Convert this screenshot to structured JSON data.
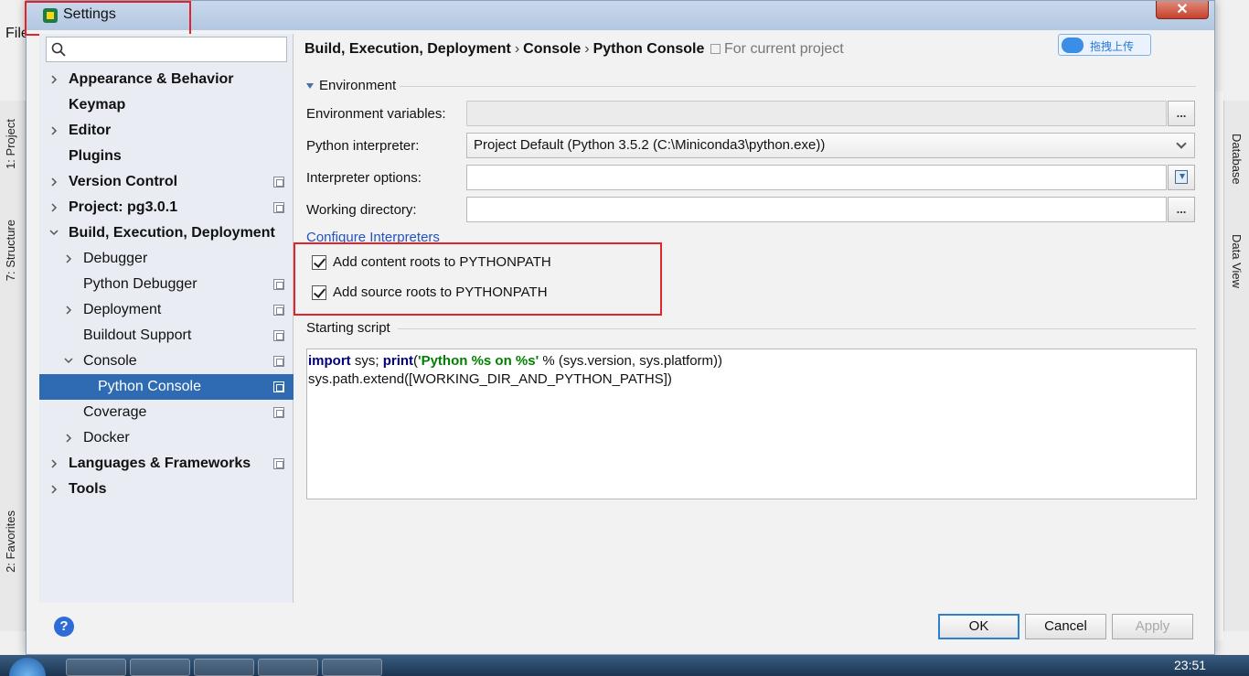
{
  "window": {
    "title": "Settings",
    "close_glyph": "✕"
  },
  "ide": {
    "menu_file": "File",
    "left_tabs": [
      "1: Project",
      "7: Structure",
      "2: Favorites"
    ],
    "right_tabs": [
      "Database",
      "Data View"
    ]
  },
  "breadcrumb": [
    "Build, Execution, Deployment",
    "Console",
    "Python Console"
  ],
  "breadcrumb_sep": "›",
  "scope": "For current project",
  "upload_button": "拖拽上传",
  "search": {
    "value": "",
    "placeholder": ""
  },
  "tree": [
    {
      "label": "Appearance & Behavior",
      "level": 0,
      "expandable": true,
      "bold": true,
      "copy": false
    },
    {
      "label": "Keymap",
      "level": 0,
      "expandable": false,
      "bold": true,
      "copy": false
    },
    {
      "label": "Editor",
      "level": 0,
      "expandable": true,
      "bold": true,
      "copy": false
    },
    {
      "label": "Plugins",
      "level": 0,
      "expandable": false,
      "bold": true,
      "copy": false
    },
    {
      "label": "Version Control",
      "level": 0,
      "expandable": true,
      "bold": true,
      "copy": true
    },
    {
      "label": "Project: pg3.0.1",
      "level": 0,
      "expandable": true,
      "bold": true,
      "copy": true
    },
    {
      "label": "Build, Execution, Deployment",
      "level": 0,
      "expandable": true,
      "expanded": true,
      "bold": true,
      "copy": false
    },
    {
      "label": "Debugger",
      "level": 1,
      "expandable": true,
      "bold": false,
      "copy": false
    },
    {
      "label": "Python Debugger",
      "level": 1,
      "expandable": false,
      "bold": false,
      "copy": true
    },
    {
      "label": "Deployment",
      "level": 1,
      "expandable": true,
      "bold": false,
      "copy": true
    },
    {
      "label": "Buildout Support",
      "level": 1,
      "expandable": false,
      "bold": false,
      "copy": true
    },
    {
      "label": "Console",
      "level": 1,
      "expandable": true,
      "expanded": true,
      "bold": false,
      "copy": true
    },
    {
      "label": "Python Console",
      "level": 2,
      "expandable": false,
      "bold": false,
      "copy": true,
      "selected": true
    },
    {
      "label": "Coverage",
      "level": 1,
      "expandable": false,
      "bold": false,
      "copy": true
    },
    {
      "label": "Docker",
      "level": 1,
      "expandable": true,
      "bold": false,
      "copy": false
    },
    {
      "label": "Languages & Frameworks",
      "level": 0,
      "expandable": true,
      "bold": true,
      "copy": true
    },
    {
      "label": "Tools",
      "level": 0,
      "expandable": true,
      "bold": true,
      "copy": false
    }
  ],
  "environment": {
    "section_title": "Environment",
    "env_vars_label": "Environment variables:",
    "env_vars_value": "",
    "interpreter_label": "Python interpreter:",
    "interpreter_value": "Project Default (Python 3.5.2 (C:\\Miniconda3\\python.exe))",
    "options_label": "Interpreter options:",
    "options_value": "",
    "workdir_label": "Working directory:",
    "workdir_value": "",
    "browse_label": "...",
    "configure_link": "Configure Interpreters",
    "add_content_roots": {
      "label": "Add content roots to PYTHONPATH",
      "checked": true
    },
    "add_source_roots": {
      "label": "Add source roots to PYTHONPATH",
      "checked": true
    }
  },
  "starting_script": {
    "section_title": "Starting script",
    "line1": {
      "kw1": "import",
      "t1": " sys; ",
      "kw2": "print",
      "t2": "(",
      "str": "'Python %s on %s'",
      "t3": " % (sys.version, sys.platform))"
    },
    "line2": "sys.path.extend([WORKING_DIR_AND_PYTHON_PATHS])"
  },
  "buttons": {
    "help": "?",
    "ok": "OK",
    "cancel": "Cancel",
    "apply": "Apply"
  },
  "taskbar": {
    "clock": "23:51"
  },
  "colors": {
    "selection": "#2f6bb3",
    "highlight_box": "#e0242a",
    "link": "#2453bf"
  }
}
